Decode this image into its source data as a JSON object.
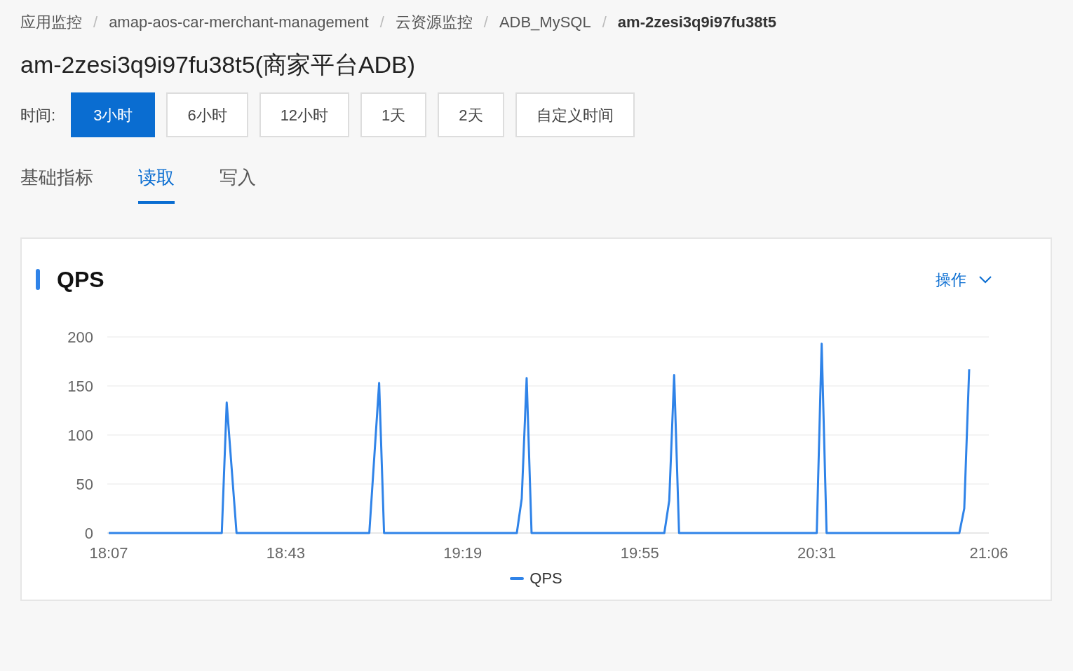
{
  "breadcrumb": [
    {
      "text": "应用监控",
      "current": false
    },
    {
      "separator": "/",
      "text": "amap-aos-car-merchant-management",
      "current": false
    },
    {
      "separator": "/",
      "text": "云资源监控",
      "current": false
    },
    {
      "separator": "/",
      "text": "ADB_MySQL",
      "current": false
    },
    {
      "separator": "/",
      "text": "am-2zesi3q9i97fu38t5",
      "current": true
    }
  ],
  "title": "am-2zesi3q9i97fu38t5(商家平台ADB)",
  "time_filter": {
    "label": "时间:",
    "options": [
      {
        "label": "3小时",
        "selected": true
      },
      {
        "label": "6小时",
        "selected": false
      },
      {
        "label": "12小时",
        "selected": false
      },
      {
        "label": "1天",
        "selected": false
      },
      {
        "label": "2天",
        "selected": false
      },
      {
        "label": "自定义时间",
        "selected": false
      }
    ]
  },
  "tabs": [
    {
      "label": "基础指标",
      "selected": false
    },
    {
      "label": "读取",
      "selected": true
    },
    {
      "label": "写入",
      "selected": false
    }
  ],
  "panel": {
    "title": "QPS",
    "action_label": "操作",
    "chart_data": {
      "type": "line",
      "x": [
        1087,
        1110,
        1111,
        1113,
        1140,
        1142,
        1143,
        1170,
        1171,
        1172,
        1173,
        1200,
        1201,
        1202,
        1203,
        1231,
        1232,
        1233,
        1260,
        1261,
        1262
      ],
      "series": [
        {
          "name": "QPS",
          "color": "#2f83e8",
          "values": [
            0,
            0,
            133,
            0,
            0,
            153,
            0,
            0,
            35,
            158,
            0,
            0,
            33,
            161,
            0,
            0,
            193,
            0,
            0,
            25,
            167
          ]
        }
      ],
      "xlim": [
        1087,
        1266
      ],
      "ylim": [
        0,
        200
      ],
      "grid": true,
      "xticks": [
        {
          "value": 1087,
          "label": "18:07"
        },
        {
          "value": 1123,
          "label": "18:43"
        },
        {
          "value": 1159,
          "label": "19:19"
        },
        {
          "value": 1195,
          "label": "19:55"
        },
        {
          "value": 1231,
          "label": "20:31"
        },
        {
          "value": 1266,
          "label": "21:06"
        }
      ],
      "yticks": [
        0,
        50,
        100,
        150,
        200
      ]
    }
  }
}
